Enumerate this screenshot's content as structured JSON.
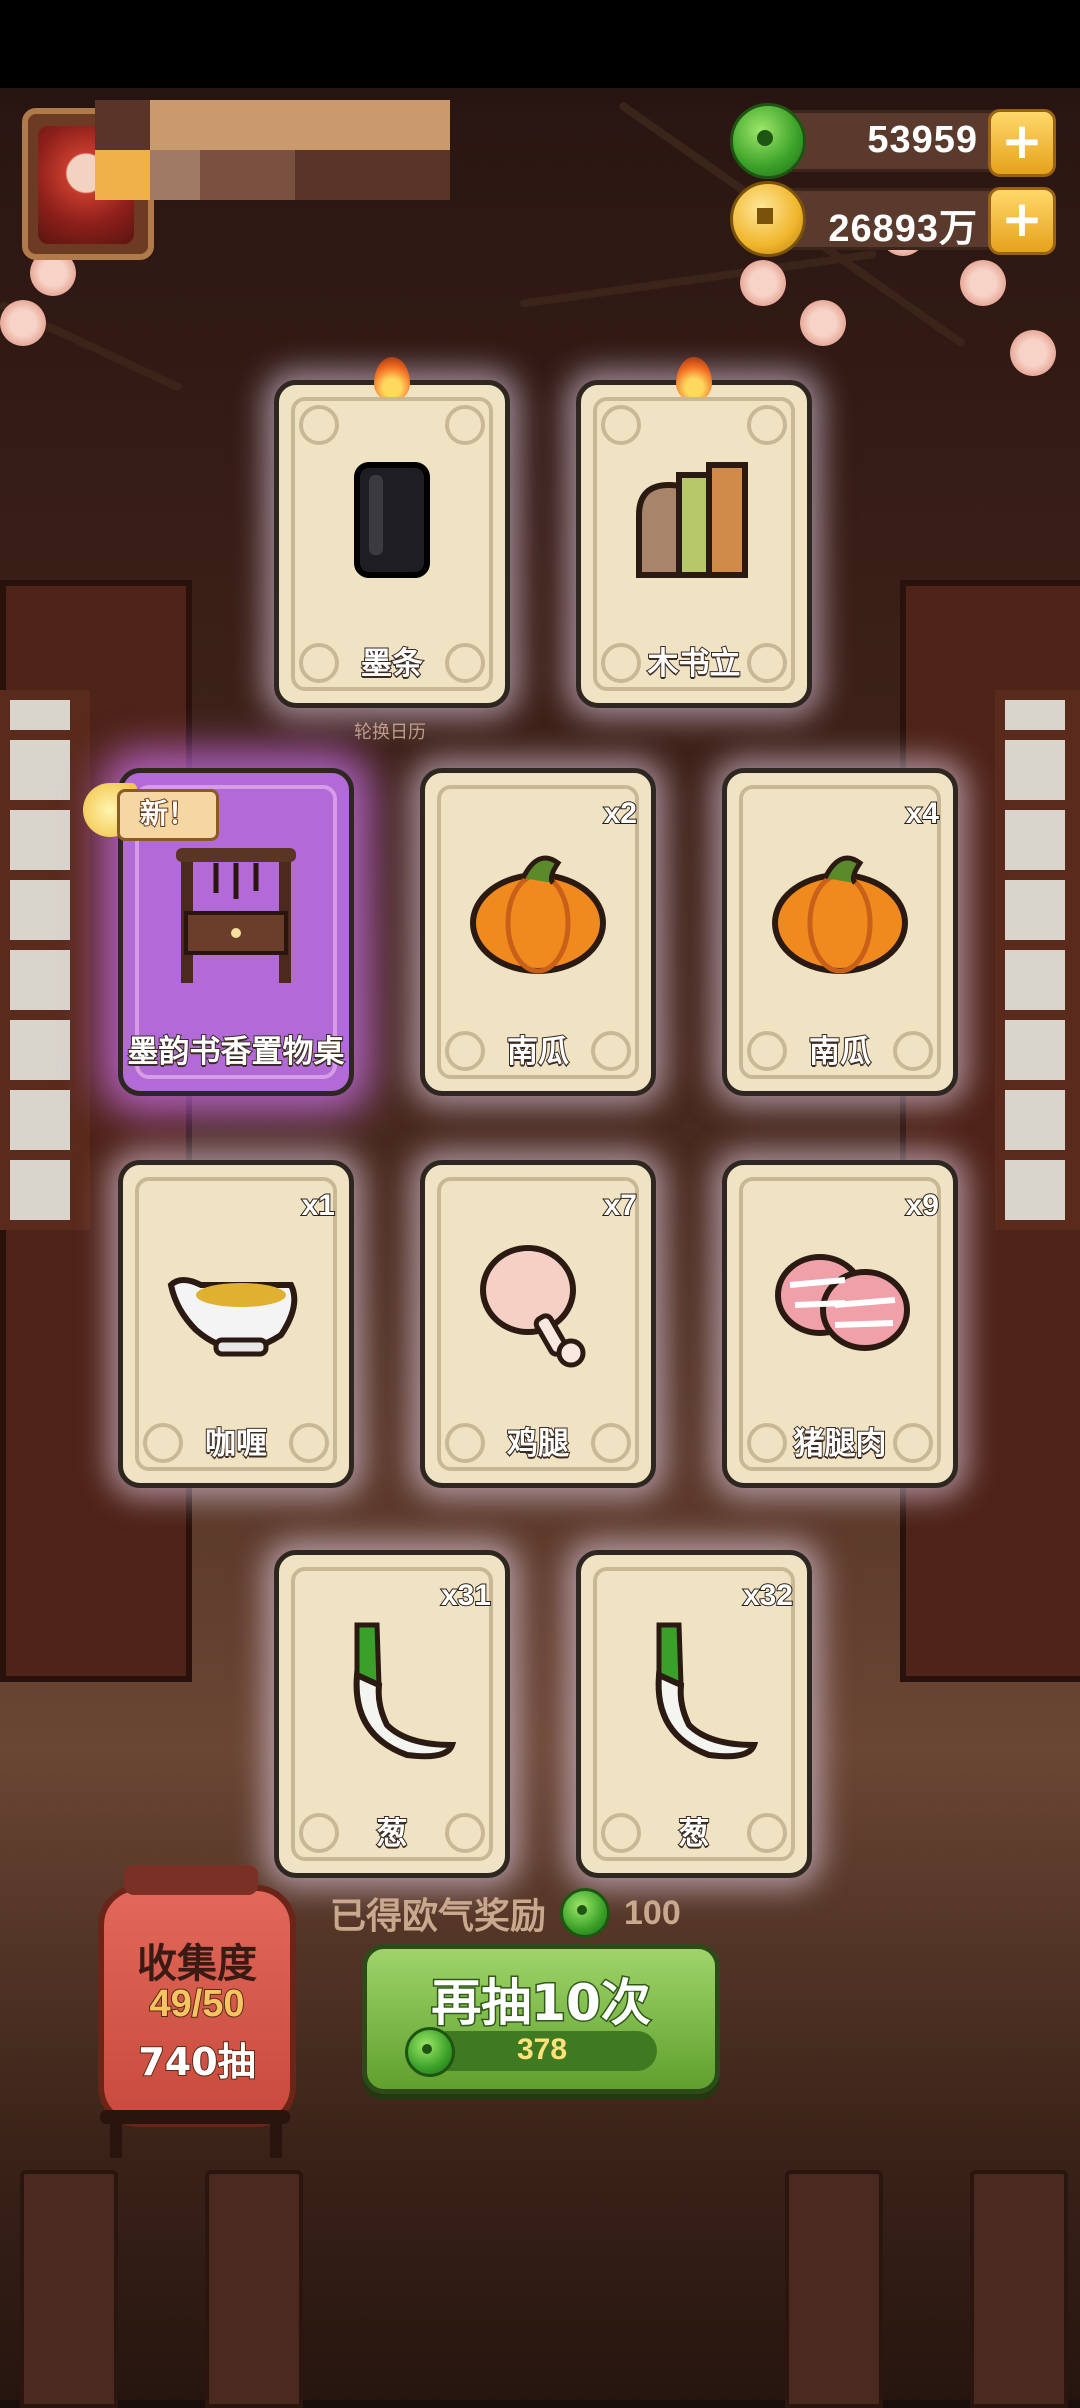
{
  "currencies": {
    "jade_value": "53959",
    "coins_value": "26893万"
  },
  "featured_cards": [
    {
      "name": "墨条",
      "qty": "",
      "icon": "ink-stick-icon"
    },
    {
      "name": "木书立",
      "qty": "",
      "icon": "wooden-bookend-icon"
    }
  ],
  "divider_label": "轮换日历",
  "cards": [
    {
      "name": "墨韵书香置物桌",
      "qty": "",
      "icon": "furniture-shelf-icon",
      "new_badge": "新！"
    },
    {
      "name": "南瓜",
      "qty": "x2",
      "icon": "pumpkin-icon"
    },
    {
      "name": "南瓜",
      "qty": "x4",
      "icon": "pumpkin-icon"
    },
    {
      "name": "咖喱",
      "qty": "x1",
      "icon": "curry-boat-icon"
    },
    {
      "name": "鸡腿",
      "qty": "x7",
      "icon": "chicken-leg-icon"
    },
    {
      "name": "猪腿肉",
      "qty": "x9",
      "icon": "pork-leg-icon"
    },
    {
      "name": "葱",
      "qty": "x31",
      "icon": "green-onion-icon"
    },
    {
      "name": "葱",
      "qty": "x32",
      "icon": "green-onion-icon"
    }
  ],
  "collection": {
    "title": "收集度",
    "progress": "49/50",
    "draws": "740抽"
  },
  "reward": {
    "label": "已得欧气奖励",
    "value": "100"
  },
  "redraw_button": {
    "label": "再抽10次",
    "cost": "378"
  },
  "colors": {
    "accent_green": "#5fa02e",
    "gold": "#f0b62c",
    "rare_purple": "#b26ad6"
  }
}
